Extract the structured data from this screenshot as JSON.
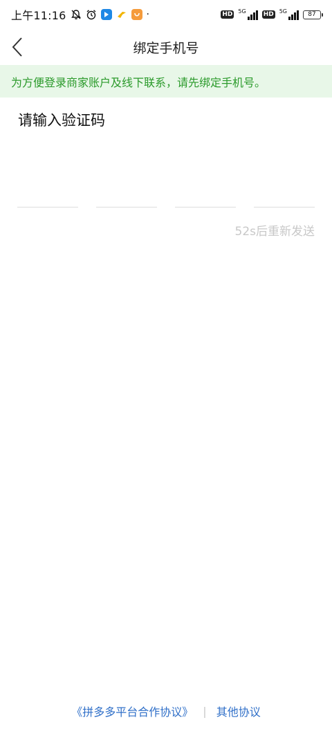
{
  "status_bar": {
    "time": "上午11:16",
    "icons": [
      "bell-muted-icon",
      "alarm-icon",
      "app-blue-icon",
      "app-yellow-icon",
      "app-orange-icon"
    ],
    "hd1": "HD",
    "net1_label": "5G",
    "hd2": "HD",
    "net2_label": "5G",
    "battery": "87",
    "colors": {
      "blue_app": "#1e88e5",
      "yellow_app": "#f2b400",
      "orange_app": "#f59b3b"
    }
  },
  "nav": {
    "title": "绑定手机号",
    "back_icon": "chevron-left-icon"
  },
  "notice": {
    "text": "为方便登录商家账户及线下联系，请先绑定手机号。",
    "color": "#2a9a2a",
    "background": "#e8f7e8"
  },
  "verification": {
    "title": "请输入验证码",
    "resend_text": "52s后重新发送"
  },
  "footer": {
    "agreement_link": "《拼多多平台合作协议》",
    "separator": "|",
    "other_link": "其他协议",
    "link_color": "#2f6fc8"
  }
}
